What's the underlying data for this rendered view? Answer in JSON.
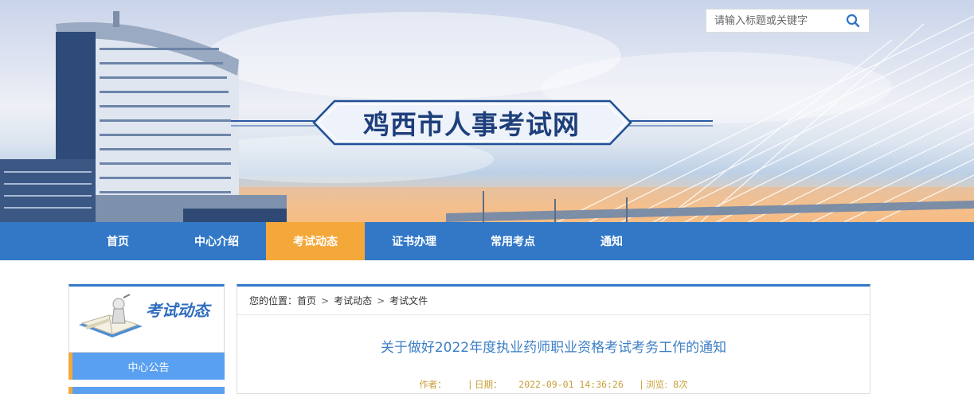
{
  "header": {
    "site_title": "鸡西市人事考试网",
    "search": {
      "placeholder": "请输入标题或关键字"
    }
  },
  "nav": {
    "items": [
      {
        "label": "首页"
      },
      {
        "label": "中心介绍"
      },
      {
        "label": "考试动态",
        "active": true
      },
      {
        "label": "证书办理"
      },
      {
        "label": "常用考点"
      },
      {
        "label": "通知"
      }
    ]
  },
  "sidebar": {
    "title": "考试动态",
    "items": [
      {
        "label": "中心公告"
      },
      {
        "label": ""
      }
    ]
  },
  "breadcrumb": {
    "prefix": "您的位置：",
    "items": [
      "首页",
      "考试动态",
      "考试文件"
    ],
    "separator": ">"
  },
  "article": {
    "title": "关于做好2022年度执业药师职业资格考试考务工作的通知",
    "author_label": "作者：",
    "date_label": "| 日期：",
    "date": "2022-09-01 14:36:26",
    "views_label": "| 浏览:",
    "views": "8次"
  },
  "colors": {
    "nav_bg": "#3278c7",
    "nav_active": "#f4a83a",
    "title_blue": "#1d3f7a",
    "sidebar_item": "#5aa0f0",
    "meta_text": "#c8a03a"
  }
}
